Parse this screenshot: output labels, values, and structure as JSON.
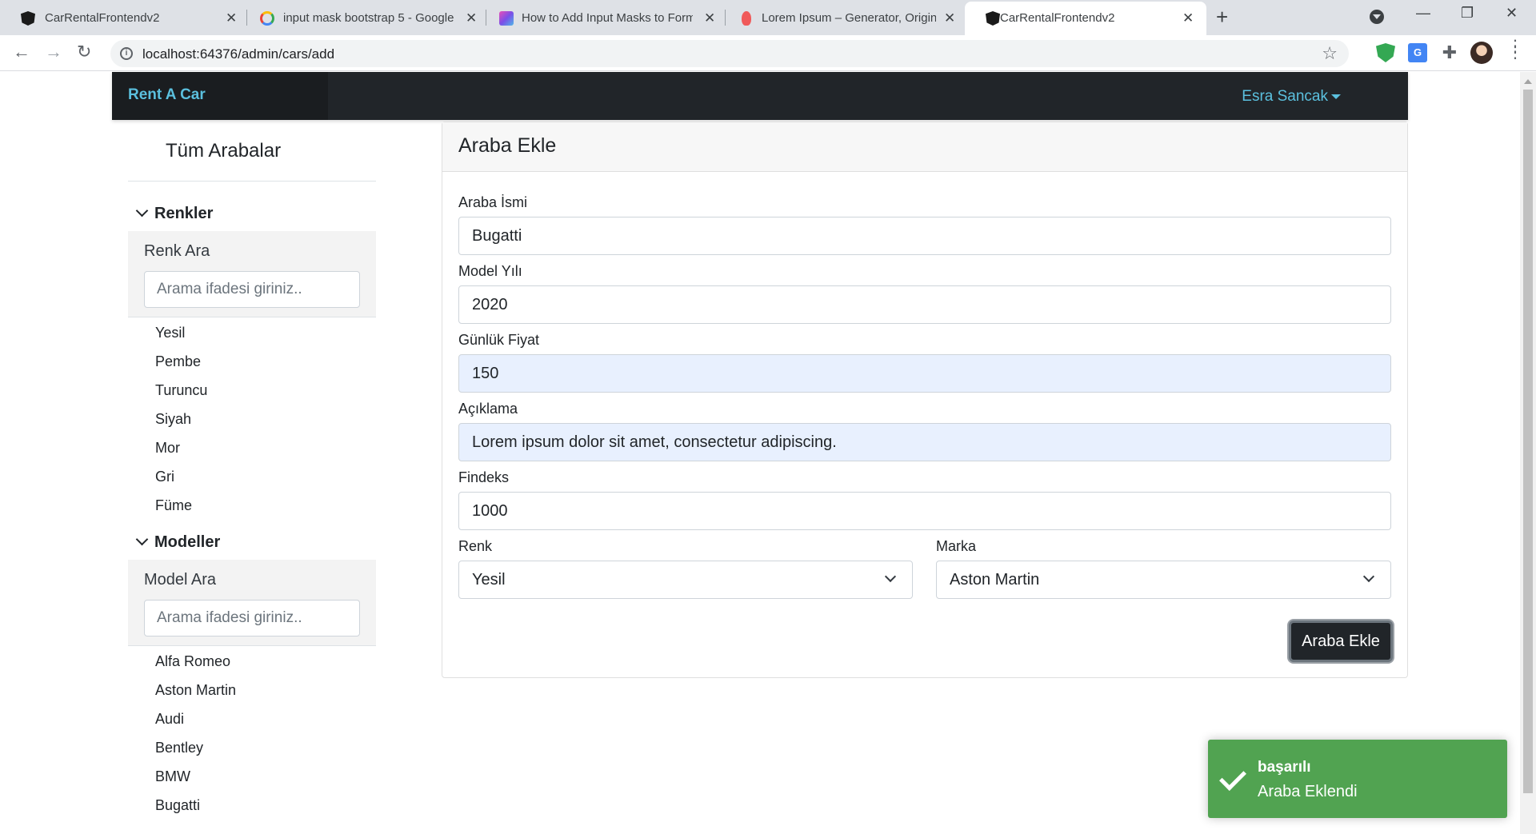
{
  "browser": {
    "tabs": [
      {
        "title": "CarRentalFrontendv2",
        "icon": "angular-icon"
      },
      {
        "title": "input mask bootstrap 5 - Google",
        "icon": "google-icon"
      },
      {
        "title": "How to Add Input Masks to Form",
        "icon": "site-icon"
      },
      {
        "title": "Lorem Ipsum – Generator, Origin",
        "icon": "lorem-icon"
      },
      {
        "title": "CarRentalFrontendv2",
        "icon": "angular-icon",
        "active": true
      }
    ],
    "url": "localhost:64376/admin/cars/add"
  },
  "navbar": {
    "brand": "Rent A Car",
    "user": "Esra Sancak"
  },
  "sidebar": {
    "title": "Tüm Arabalar",
    "colors": {
      "header": "Renkler",
      "search_label": "Renk Ara",
      "search_placeholder": "Arama ifadesi giriniz..",
      "items": [
        "Yesil",
        "Pembe",
        "Turuncu",
        "Siyah",
        "Mor",
        "Gri",
        "Füme"
      ]
    },
    "models": {
      "header": "Modeller",
      "search_label": "Model Ara",
      "search_placeholder": "Arama ifadesi giriniz..",
      "items": [
        "Alfa Romeo",
        "Aston Martin",
        "Audi",
        "Bentley",
        "BMW",
        "Bugatti"
      ]
    }
  },
  "form": {
    "title": "Araba Ekle",
    "fields": {
      "name": {
        "label": "Araba İsmi",
        "value": "Bugatti"
      },
      "model_year": {
        "label": "Model Yılı",
        "value": "2020"
      },
      "daily_price": {
        "label": "Günlük Fiyat",
        "value": "150"
      },
      "description": {
        "label": "Açıklama",
        "value": "Lorem ipsum dolor sit amet, consectetur adipiscing."
      },
      "findeks": {
        "label": "Findeks",
        "value": "1000"
      },
      "color": {
        "label": "Renk",
        "value": "Yesil"
      },
      "brand": {
        "label": "Marka",
        "value": "Aston Martin"
      }
    },
    "submit_label": "Araba Ekle"
  },
  "toast": {
    "title": "başarılı",
    "message": "Araba Eklendi",
    "color": "#51a351"
  },
  "colors": {
    "navbar_bg": "#212529",
    "brand_accent": "#5bc0de",
    "autofill_bg": "#e8f0fe"
  }
}
